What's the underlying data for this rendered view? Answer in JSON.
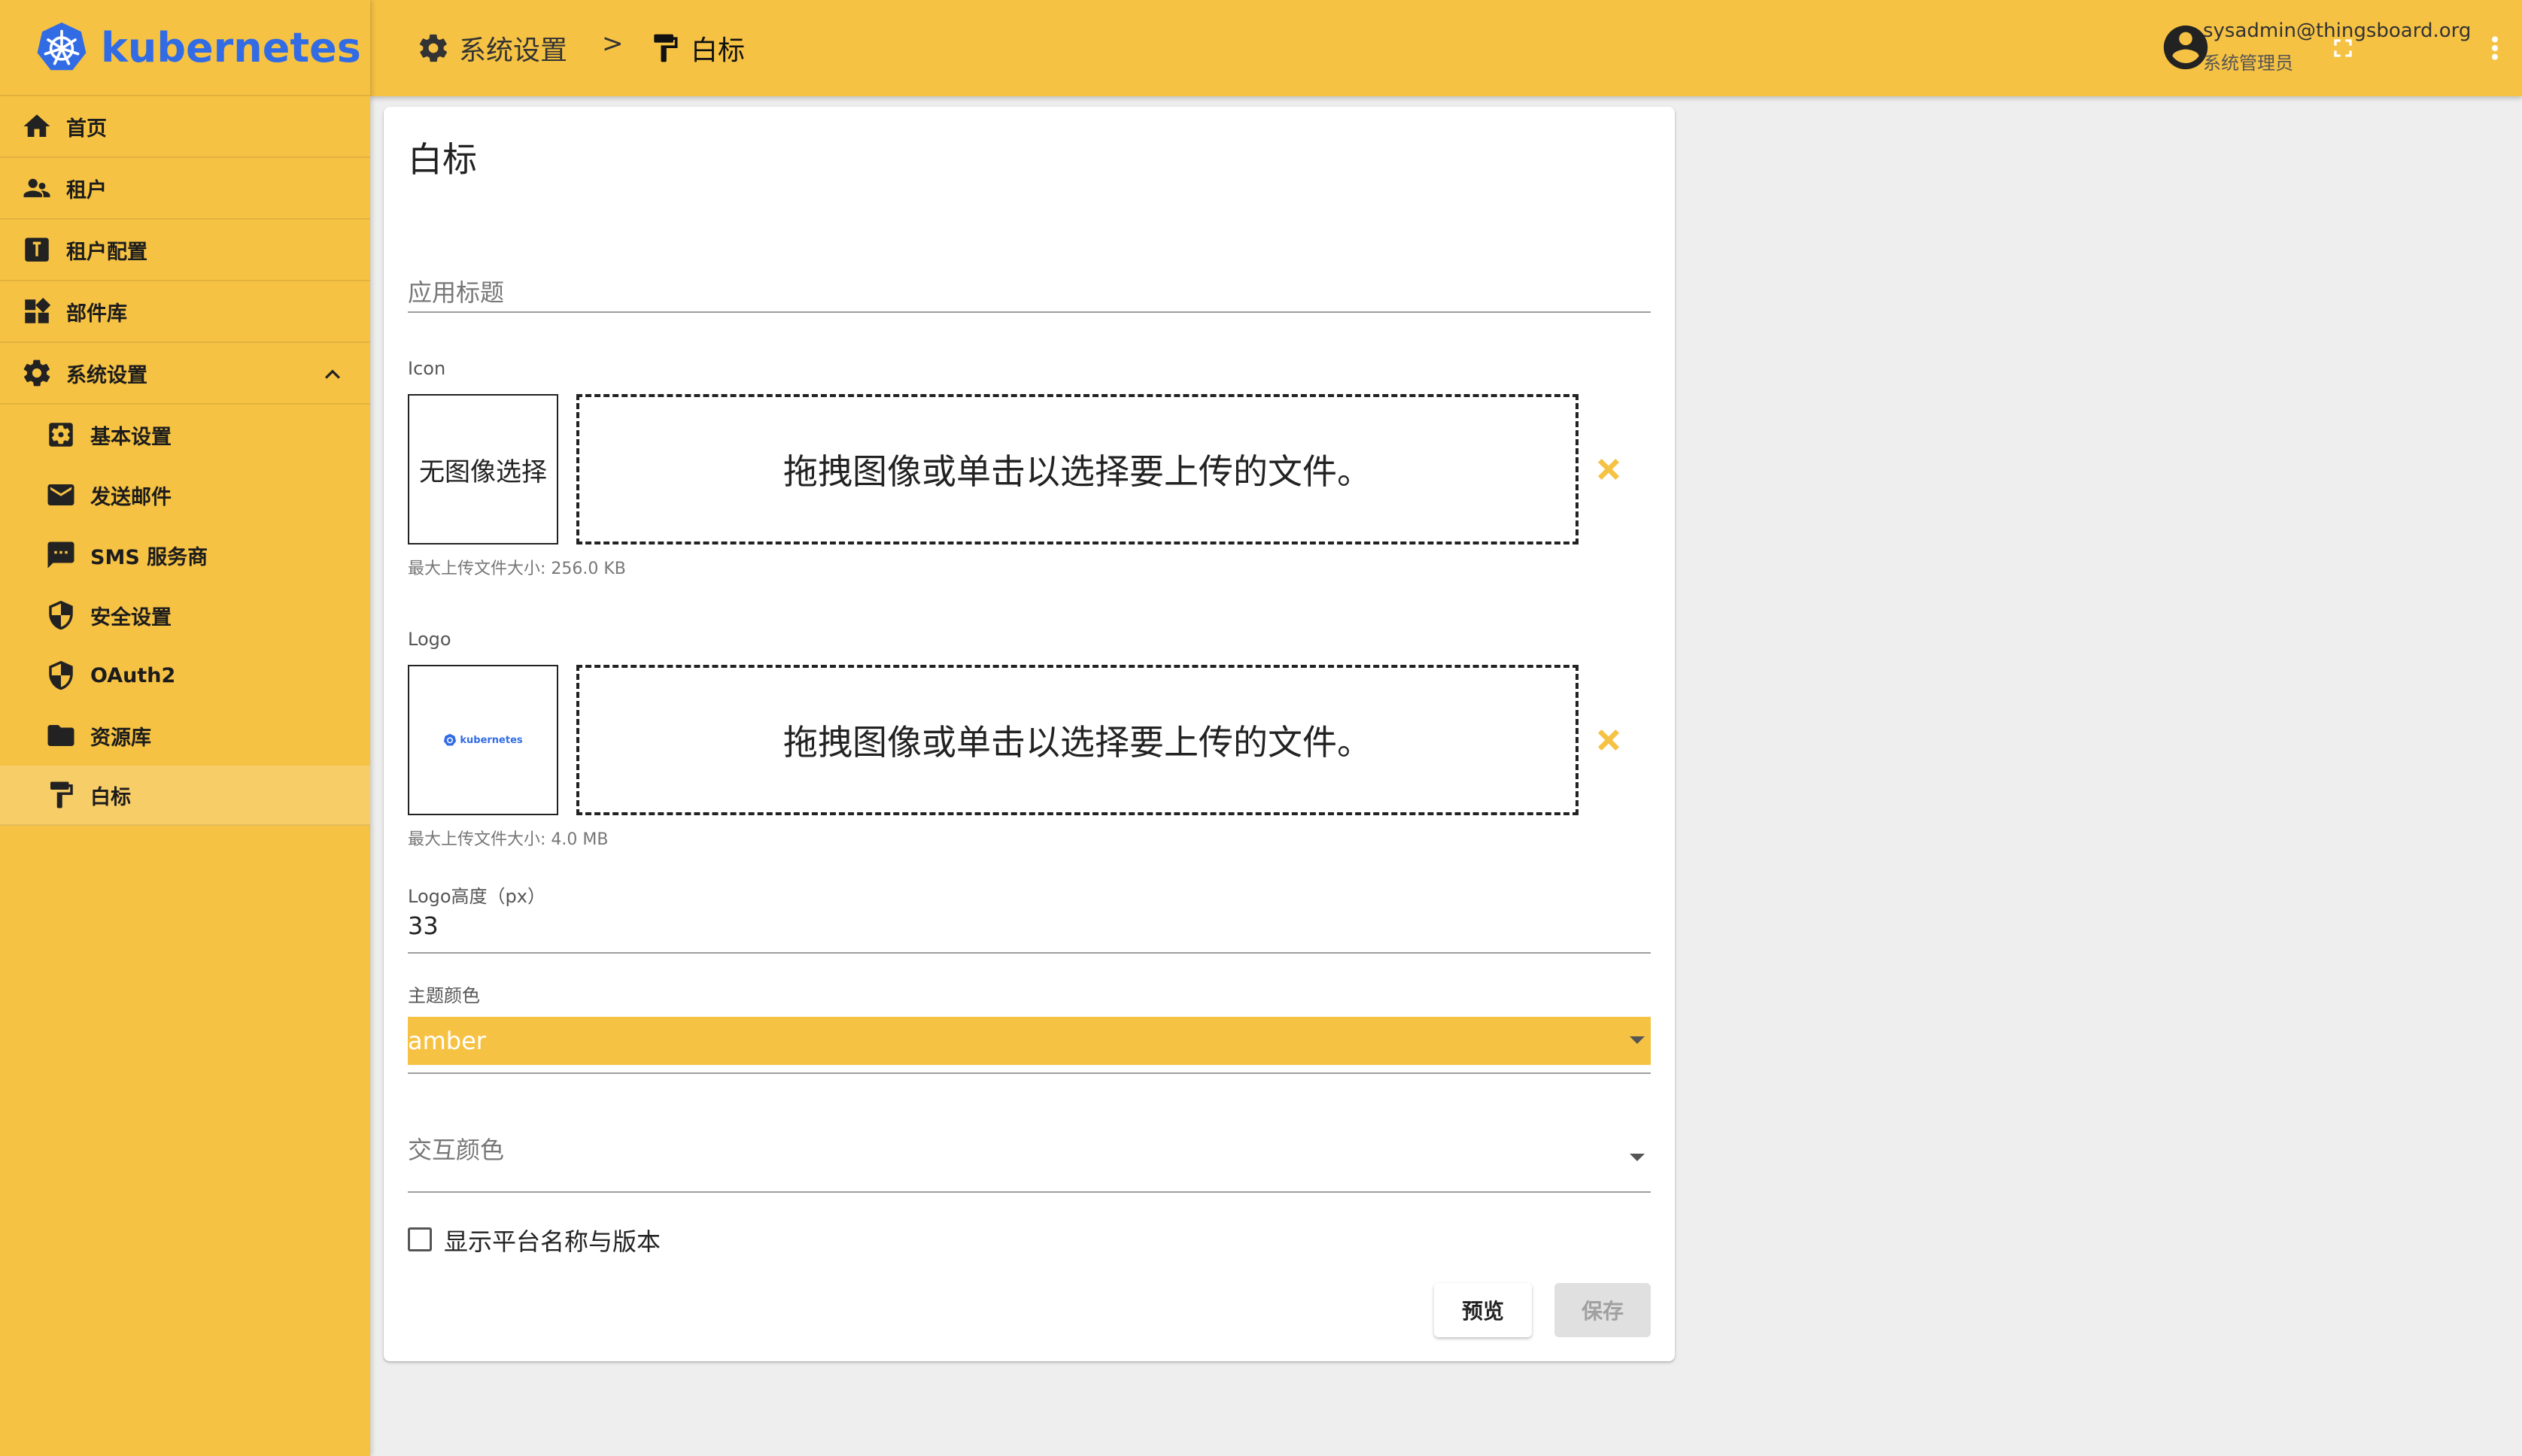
{
  "app": {
    "brand": "kubernetes"
  },
  "sidebar": {
    "items": [
      {
        "label": "首页",
        "icon": "home-icon"
      },
      {
        "label": "租户",
        "icon": "people-icon"
      },
      {
        "label": "租户配置",
        "icon": "tenant-profile-icon"
      },
      {
        "label": "部件库",
        "icon": "widgets-icon"
      },
      {
        "label": "系统设置",
        "icon": "gear-icon",
        "expanded": true
      }
    ],
    "sub_items": [
      {
        "label": "基本设置",
        "icon": "settings-applications-icon"
      },
      {
        "label": "发送邮件",
        "icon": "mail-icon"
      },
      {
        "label": "SMS 服务商",
        "icon": "sms-icon"
      },
      {
        "label": "安全设置",
        "icon": "security-icon"
      },
      {
        "label": "OAuth2",
        "icon": "shield-icon"
      },
      {
        "label": "资源库",
        "icon": "folder-icon"
      },
      {
        "label": "白标",
        "icon": "format-paint-icon",
        "active": true
      }
    ]
  },
  "header": {
    "breadcrumb": [
      {
        "label": "系统设置",
        "icon": "gear-icon"
      },
      {
        "label": "白标",
        "icon": "format-paint-icon"
      }
    ],
    "separator": ">",
    "user_name": "sysadmin@thingsboard.org",
    "user_role": "系统管理员"
  },
  "form": {
    "title": "白标",
    "app_title_placeholder": "应用标题",
    "icon": {
      "label": "Icon",
      "preview_text": "无图像选择",
      "dropzone_text": "拖拽图像或单击以选择要上传的文件。",
      "hint": "最大上传文件大小: 256.0 KB"
    },
    "logo": {
      "label": "Logo",
      "preview_brand": "kubernetes",
      "dropzone_text": "拖拽图像或单击以选择要上传的文件。",
      "hint": "最大上传文件大小: 4.0 MB"
    },
    "logo_height": {
      "label": "Logo高度（px）",
      "value": "33"
    },
    "theme_color": {
      "label": "主题颜色",
      "value": "amber"
    },
    "interaction_color": {
      "placeholder": "交互颜色"
    },
    "show_name_version": {
      "label": "显示平台名称与版本",
      "checked": false
    },
    "buttons": {
      "preview": "预览",
      "save": "保存"
    }
  },
  "colors": {
    "primary": "#f6c244",
    "brand_blue": "#326ce5",
    "background": "#eeeeee"
  }
}
